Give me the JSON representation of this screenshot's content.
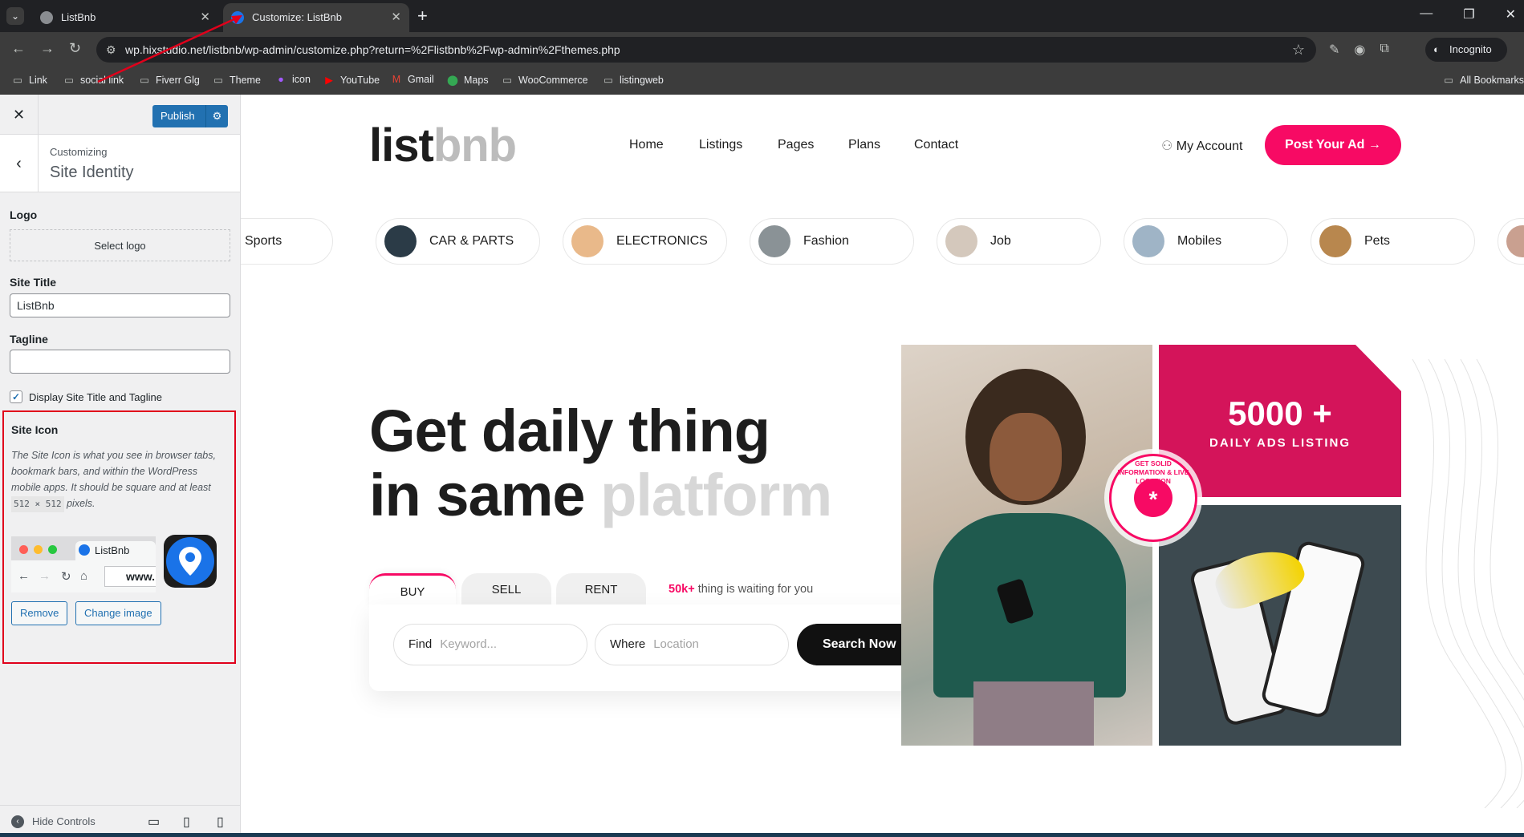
{
  "browser": {
    "tabs": [
      {
        "title": "ListBnb",
        "icon": "globe-icon"
      },
      {
        "title": "Customize: ListBnb",
        "icon": "location-pin-icon"
      }
    ],
    "url": "wp.hixstudio.net/listbnb/wp-admin/customize.php?return=%2Flistbnb%2Fwp-admin%2Fthemes.php",
    "incognito_label": "Incognito",
    "bookmarks": [
      "Link",
      "social link",
      "Fiverr Glg",
      "Theme",
      "icon",
      "YouTube",
      "Gmail",
      "Maps",
      "WooCommerce",
      "listingweb"
    ],
    "all_bookmarks": "All Bookmarks"
  },
  "customizer": {
    "publish_label": "Publish",
    "customizing_label": "Customizing",
    "section_title": "Site Identity",
    "logo_label": "Logo",
    "select_logo_label": "Select logo",
    "site_title_label": "Site Title",
    "site_title_value": "ListBnb",
    "tagline_label": "Tagline",
    "tagline_value": "",
    "display_checkbox_label": "Display Site Title and Tagline",
    "display_checked": true,
    "site_icon": {
      "title": "Site Icon",
      "description_before": "The Site Icon is what you see in browser tabs, bookmark bars, and within the WordPress mobile apps. It should be square and at least",
      "size_code": "512 × 512",
      "description_after": "pixels.",
      "preview_tab_title": "ListBnb",
      "preview_url": "www.",
      "remove_label": "Remove",
      "change_label": "Change image"
    },
    "hide_controls_label": "Hide Controls"
  },
  "site": {
    "logo_part1": "list",
    "logo_part2": "bnb",
    "nav": [
      "Home",
      "Listings",
      "Pages",
      "Plans",
      "Contact"
    ],
    "my_account": "My Account",
    "post_ad": "Post Your Ad",
    "categories": [
      "Sports",
      "CAR & PARTS",
      "ELECTRONICS",
      "Fashion",
      "Job",
      "Mobiles",
      "Pets"
    ],
    "hero_line1": "Get daily thing",
    "hero_line2_dark": "in same",
    "hero_line2_light": "platform",
    "search_tabs": [
      "BUY",
      "SELL",
      "RENT"
    ],
    "waiting_count": "50k+",
    "waiting_text": "thing is waiting for you",
    "find_label": "Find",
    "find_placeholder": "Keyword...",
    "where_label": "Where",
    "where_placeholder": "Location",
    "search_button": "Search Now",
    "promo_number": "5000 +",
    "promo_subtitle": "DAILY ADS LISTING",
    "seal_text": "GET SOLID INFORMATION & LIVE LOCATION"
  },
  "colors": {
    "accent": "#f70a64",
    "wp_blue": "#2271b1",
    "highlight_red": "#e0001b"
  }
}
